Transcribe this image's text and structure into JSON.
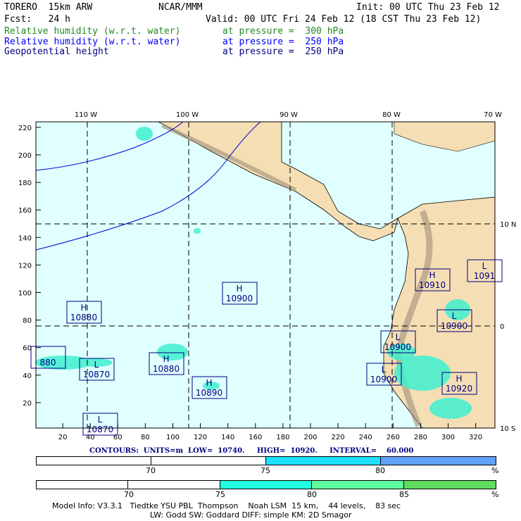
{
  "header": {
    "model": "TORERO  15km ARW",
    "org": "NCAR/MMM",
    "init": "Init: 00 UTC Thu 23 Feb 12",
    "fcst": "Fcst:   24 h",
    "valid": "Valid: 00 UTC Fri 24 Feb 12 (18 CST Thu 23 Feb 12)"
  },
  "fields": [
    {
      "name": "Relative humidity (w.r.t. water)",
      "level": "at pressure =  300 hPa",
      "color": "#228b22"
    },
    {
      "name": "Relative humidity (w.r.t. water)",
      "level": "at pressure =  250 hPa",
      "color": "#0000ff"
    },
    {
      "name": "Geopotential height",
      "level": "at pressure =  250 hPa",
      "color": "#000080"
    }
  ],
  "map": {
    "top_labels": [
      "110 W",
      "100 W",
      "90 W",
      "80 W",
      "70 W"
    ],
    "right_labels": [
      "10 N",
      "0",
      "10 S"
    ],
    "x_ticks": [
      "20",
      "40",
      "60",
      "80",
      "100",
      "120",
      "140",
      "160",
      "180",
      "200",
      "220",
      "240",
      "260",
      "280",
      "300",
      "320"
    ],
    "y_ticks": [
      "20",
      "40",
      "60",
      "80",
      "100",
      "120",
      "140",
      "160",
      "180",
      "200",
      "220"
    ],
    "centers": [
      {
        "type": "H",
        "value": "10880"
      },
      {
        "type": "H",
        "value": "10900"
      },
      {
        "type": "L",
        "value": "10870"
      },
      {
        "type": "H",
        "value": "10880"
      },
      {
        "type": "H",
        "value": "10890"
      },
      {
        "type": "",
        "value": "880"
      },
      {
        "type": "L",
        "value": "10870"
      },
      {
        "type": "H",
        "value": "10910"
      },
      {
        "type": "L",
        "value": "1091"
      },
      {
        "type": "L",
        "value": "10900"
      },
      {
        "type": "L",
        "value": "10900"
      },
      {
        "type": "L",
        "value": "10900"
      },
      {
        "type": "H",
        "value": "10920"
      }
    ],
    "colors": {
      "ocean": "#e0ffff",
      "land": "#f5deb3",
      "mountain": "#a0907a",
      "contour": "#000080"
    }
  },
  "contours": "CONTOURS:  UNITS=m  LOW=  10740.     HIGH=  10920.     INTERVAL=    60.000",
  "bar1": {
    "labels": [
      "70",
      "75",
      "80",
      "%"
    ],
    "colors": [
      "#ffffff",
      "#ffffff",
      "#1ee1ff",
      "#60a0ff"
    ]
  },
  "bar2": {
    "labels": [
      "70",
      "75",
      "80",
      "85",
      "%"
    ],
    "colors": [
      "#ffffff",
      "#ffffff",
      "#20ffe0",
      "#60ffa0",
      "#60dd60"
    ]
  },
  "footer": {
    "line1": "Model Info: V3.3.1   Tiedtke YSU PBL  Thompson    Noah LSM  15 km,    44 levels,    83 sec",
    "line2": "LW: Godd SW: Goddard DIFF: simple KM: 2D Smagor"
  }
}
